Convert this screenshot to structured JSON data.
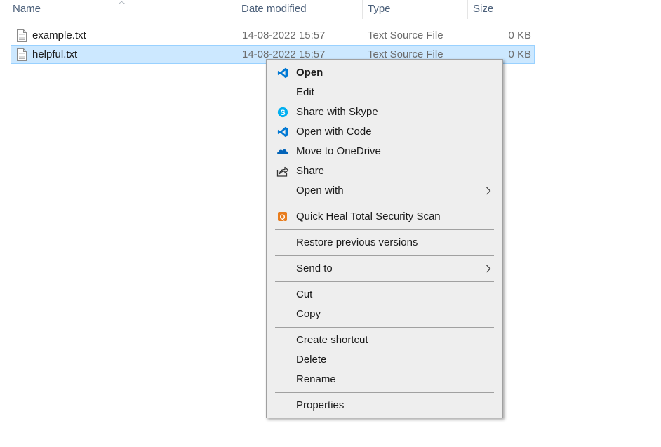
{
  "columns": {
    "name": "Name",
    "date": "Date modified",
    "type": "Type",
    "size": "Size"
  },
  "files": [
    {
      "name": "example.txt",
      "date": "14-08-2022 15:57",
      "type": "Text Source File",
      "size": "0 KB"
    },
    {
      "name": "helpful.txt",
      "date": "14-08-2022 15:57",
      "type": "Text Source File",
      "size": "0 KB"
    }
  ],
  "menu": {
    "open": "Open",
    "edit": "Edit",
    "share_skype": "Share with Skype",
    "open_code": "Open with Code",
    "move_onedrive": "Move to OneDrive",
    "share": "Share",
    "open_with": "Open with",
    "quick_heal": "Quick Heal Total Security Scan",
    "restore": "Restore previous versions",
    "send_to": "Send to",
    "cut": "Cut",
    "copy": "Copy",
    "create_shortcut": "Create shortcut",
    "delete": "Delete",
    "rename": "Rename",
    "properties": "Properties"
  },
  "icons": {
    "vscode": "vscode-icon",
    "skype": "skype-icon",
    "onedrive": "onedrive-icon",
    "share": "share-icon",
    "quickheal": "quick-heal-icon",
    "chevron": "chevron-right-icon",
    "file": "text-file-icon"
  },
  "colors": {
    "selection_bg": "#cce8ff",
    "selection_border": "#99d1ff",
    "menu_bg": "#eeeeee",
    "vscode_blue": "#0078d4",
    "skype_blue": "#00aff0",
    "onedrive_blue": "#0364b8",
    "quickheal_orange": "#e87d1e"
  }
}
